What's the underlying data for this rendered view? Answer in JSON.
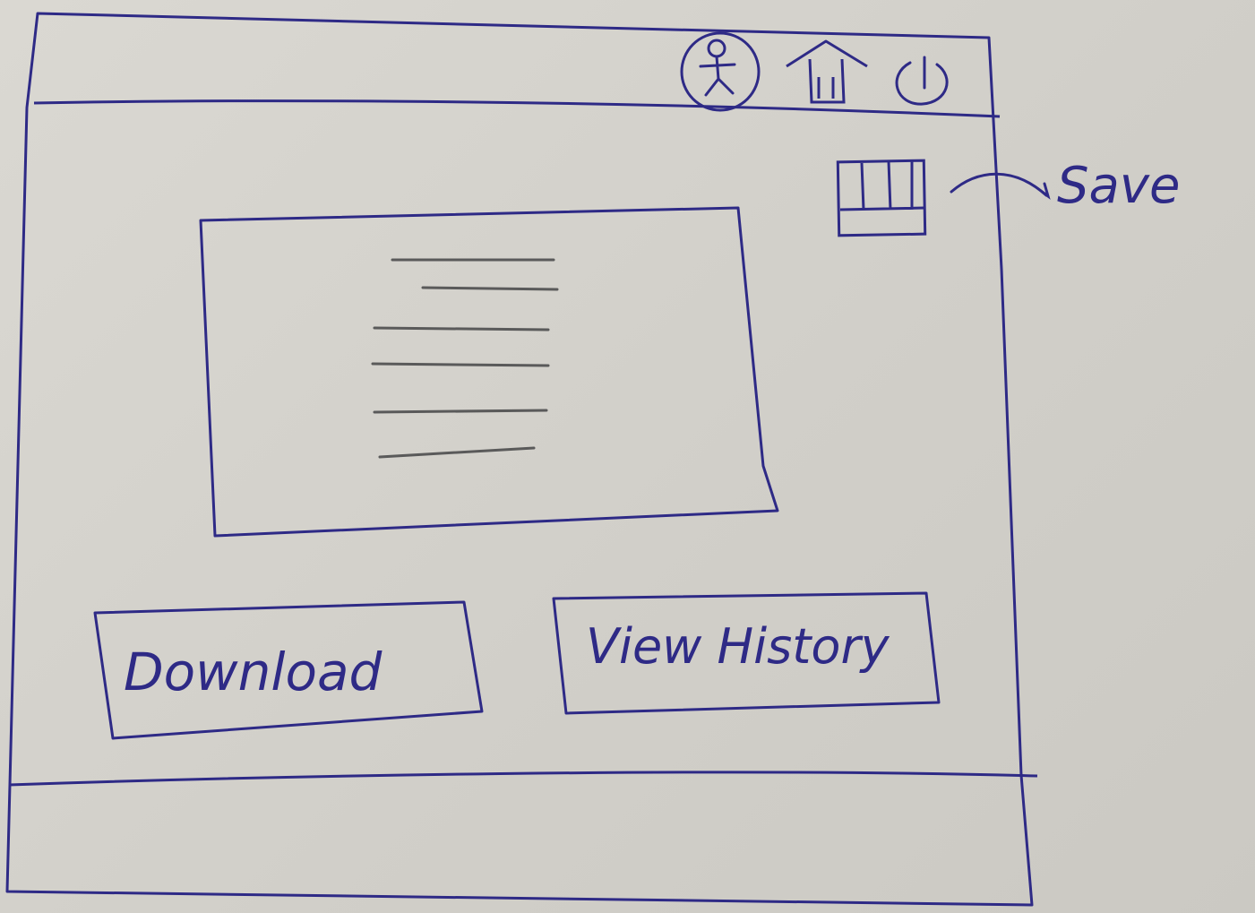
{
  "header": {
    "icons": [
      "user-icon",
      "home-icon",
      "power-icon"
    ]
  },
  "content": {
    "save_icon": "save-icon",
    "annotation_label": "Save",
    "document_preview_lines": 6
  },
  "buttons": {
    "download_label": "Download",
    "view_history_label": "View History"
  },
  "colors": {
    "ink": "#2e2a86",
    "pencil": "#5a5a5a",
    "paper": "#d6d4ce"
  }
}
